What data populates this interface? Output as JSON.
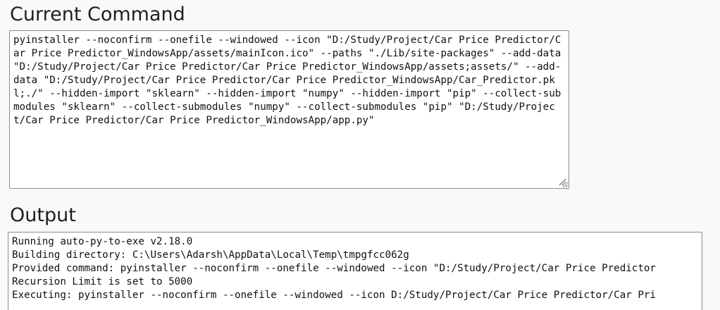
{
  "current_command": {
    "title": "Current Command",
    "text": "pyinstaller --noconfirm --onefile --windowed --icon \"D:/Study/Project/Car Price Predictor/Car Price Predictor_WindowsApp/assets/mainIcon.ico\" --paths \"./Lib/site-packages\" --add-data \"D:/Study/Project/Car Price Predictor/Car Price Predictor_WindowsApp/assets;assets/\" --add-data \"D:/Study/Project/Car Price Predictor/Car Price Predictor_WindowsApp/Car_Predictor.pkl;./\" --hidden-import \"sklearn\" --hidden-import \"numpy\" --hidden-import \"pip\" --collect-submodules \"sklearn\" --collect-submodules \"numpy\" --collect-submodules \"pip\" \"D:/Study/Project/Car Price Predictor/Car Price Predictor_WindowsApp/app.py\""
  },
  "output": {
    "title": "Output",
    "lines": [
      "Running auto-py-to-exe v2.18.0",
      "Building directory: C:\\Users\\Adarsh\\AppData\\Local\\Temp\\tmpgfcc062g",
      "Provided command: pyinstaller --noconfirm --onefile --windowed --icon \"D:/Study/Project/Car Price Predictor",
      "Recursion Limit is set to 5000",
      "Executing: pyinstaller --noconfirm --onefile --windowed --icon D:/Study/Project/Car Price Predictor/Car Pri"
    ]
  }
}
